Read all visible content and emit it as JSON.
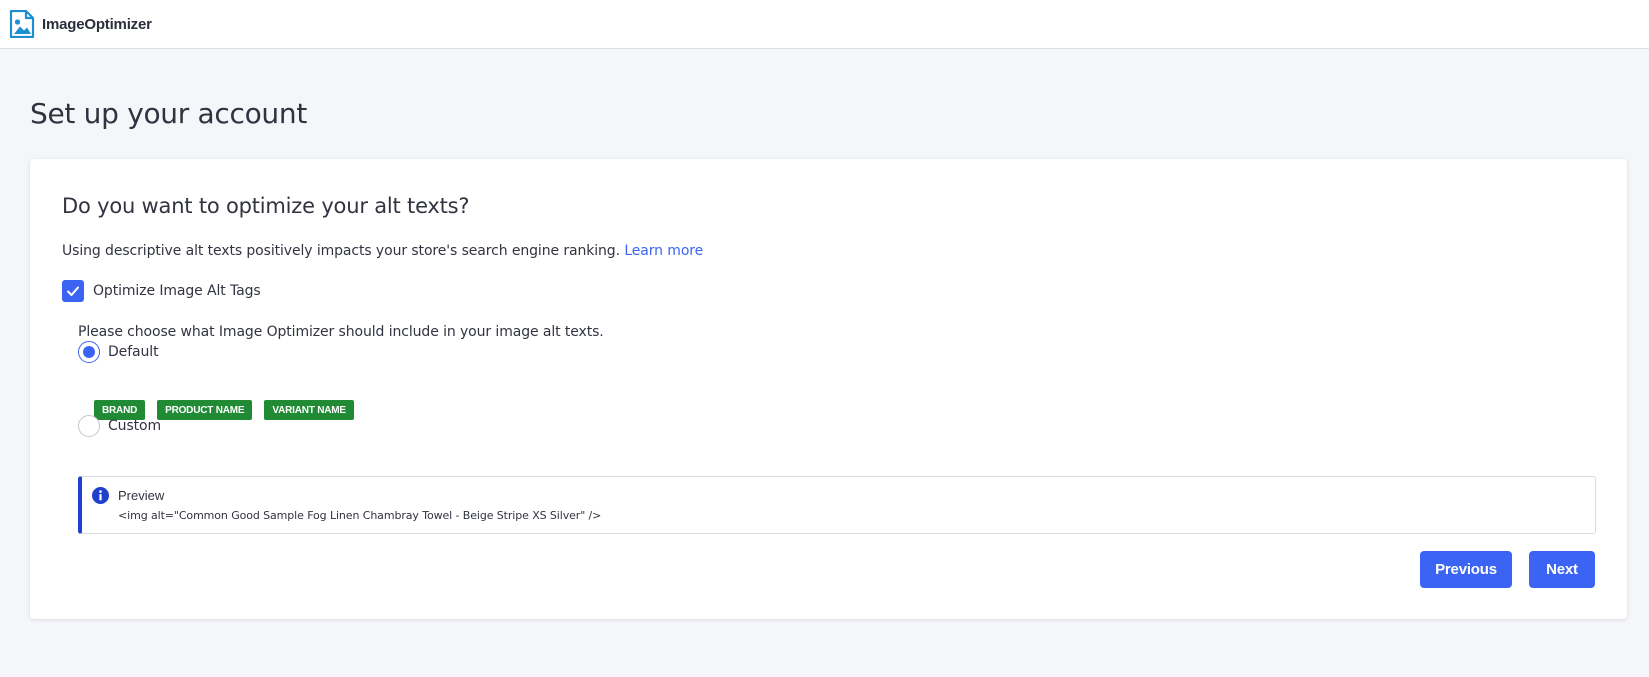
{
  "app": {
    "name_part1": "Image",
    "name_part2": "Optimizer",
    "icon": "image-file-icon",
    "brand_color": "#1b8fcf"
  },
  "page": {
    "title": "Set up your account"
  },
  "card": {
    "heading": "Do you want to optimize your alt texts?",
    "description": "Using descriptive alt texts positively impacts your store's search engine ranking.",
    "learn_more": "Learn more",
    "checkbox": {
      "label": "Optimize Image Alt Tags",
      "checked": true
    },
    "choose_text": "Please choose what Image Optimizer should include in your image alt texts.",
    "options": [
      {
        "label": "Default",
        "selected": true
      },
      {
        "label": "Custom",
        "selected": false
      }
    ],
    "tags": [
      "BRAND",
      "PRODUCT NAME",
      "VARIANT NAME"
    ],
    "preview": {
      "title": "Preview",
      "code": "<img alt=\"Common Good Sample Fog Linen Chambray Towel - Beige Stripe XS Silver\" />",
      "icon": "info-icon"
    },
    "buttons": {
      "previous": "Previous",
      "next": "Next"
    }
  },
  "colors": {
    "accent": "#3c64f4",
    "tag": "#218a34",
    "preview_border": "#1f3fcf",
    "background": "#f5f6fa"
  }
}
